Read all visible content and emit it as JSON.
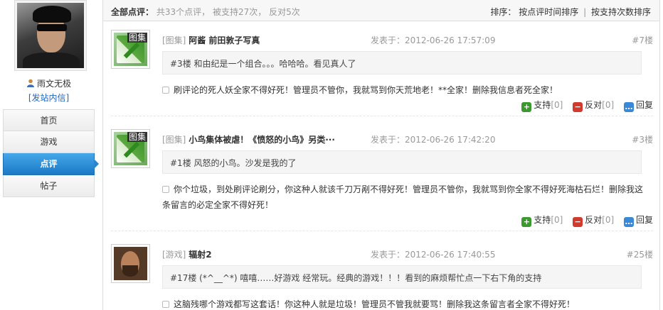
{
  "sidebar": {
    "username": "雨文无极",
    "send_msg": "[发站内信]",
    "nav": [
      "首页",
      "游戏",
      "点评",
      "帖子"
    ]
  },
  "header": {
    "all_label": "全部点评：",
    "total": "共33个点评",
    "supported": "被支持27次",
    "opposed": "反对5次",
    "sort_label": "排序：",
    "sort_time": "按点评时间排序",
    "sort_sep": "|",
    "sort_support": "按支持次数排序"
  },
  "reviews": [
    {
      "category": "[图集]",
      "title": "阿酱  前田敦子写真",
      "time": "发表于：2012-06-26 17:57:09",
      "floor": "#7楼",
      "thumb_tag": "图集",
      "quote": "#3楼  和由纪是一个组合。。。哈哈哈。看见真人了",
      "body": "刷评论的死人妖全家不得好死！管理员不管你，我就骂到你天荒地老！**全家！删除我信息者死全家！",
      "support": "支持",
      "support_count": "[0]",
      "oppose": "反对",
      "oppose_count": "[0]",
      "reply": "回复"
    },
    {
      "category": "[图集]",
      "title": "小鸟集体被虐！《愤怒的小鸟》另类···",
      "time": "发表于：2012-06-26 17:42:20",
      "floor": "#3楼",
      "thumb_tag": "图集",
      "quote": "#1楼  风怒的小鸟。沙发是我的了",
      "body": "你个垃圾，到处刷评论刷分，你这种人就该千刀万剐不得好死！管理员不管你，我就骂到你全家不得好死海枯石烂！删除我这条留言的必定全家不得好死！",
      "support": "支持",
      "support_count": "[0]",
      "oppose": "反对",
      "oppose_count": "[0]",
      "reply": "回复"
    },
    {
      "category": "[游戏]",
      "title": "辐射2",
      "time": "发表于：2012-06-26 17:40:55",
      "floor": "#25楼",
      "quote": "#17楼  (*^__^*) 嘻嘻……好游戏 经常玩。经典的游戏！！！看到的麻烦帮忙点一下右下角的支持",
      "body": "这脑残哪个游戏都写这套话！你这种人就是垃圾！管理员不管我就要骂！删除我这条留言者全家不得好死！"
    }
  ],
  "colors": {
    "accent": "#2a86cf",
    "link": "#2266bb",
    "support": "#3b9a2e",
    "oppose": "#d23a2e"
  }
}
